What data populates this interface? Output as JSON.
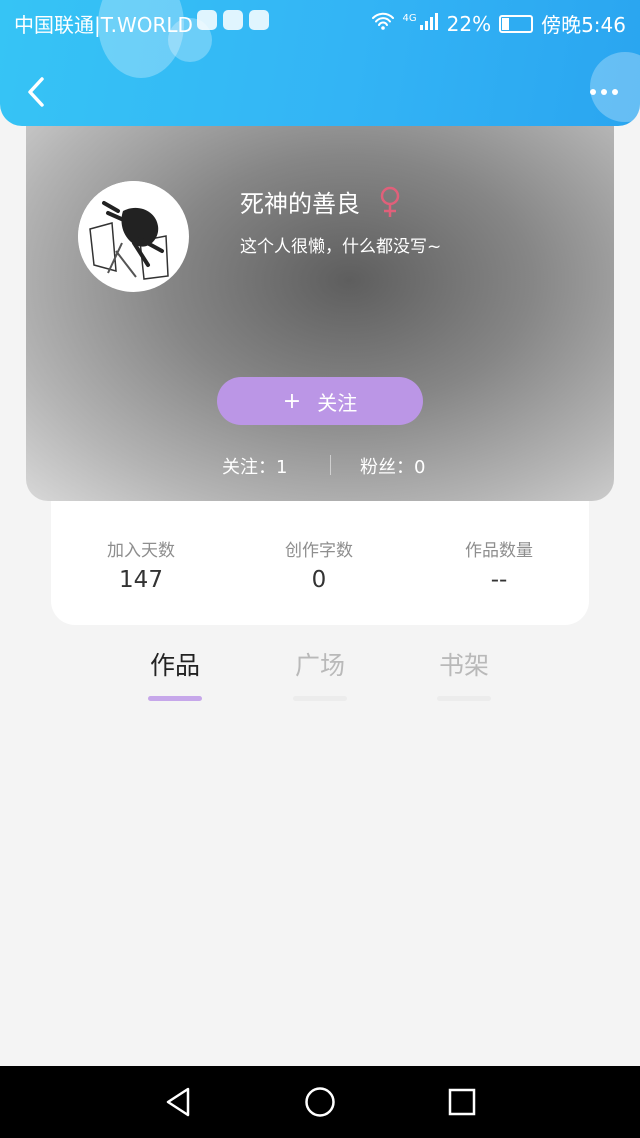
{
  "status_bar": {
    "carrier": "中国联通|T.WORLD",
    "battery": "22%",
    "time": "傍晚5:46",
    "network": "4G",
    "battery_level": 0.22,
    "icons": [
      "music-app-icon",
      "browser-app-icon",
      "huawei-app-icon",
      "wifi-icon",
      "signal-icon",
      "battery-icon"
    ]
  },
  "header": {
    "back_icon": "chevron-left-icon",
    "more_icon": "more-dots-icon",
    "color": "#33b4f5"
  },
  "profile": {
    "name": "死神的善良",
    "gender_icon": "female-icon",
    "gender_color": "#e0607a",
    "bio": "这个人很懒，什么都没写~",
    "follow_button": "关注",
    "follow_button_color": "#bb96e6",
    "following": "关注：1",
    "fans": "粉丝：0"
  },
  "stats": [
    {
      "label": "加入天数",
      "value": "147"
    },
    {
      "label": "创作字数",
      "value": "0"
    },
    {
      "label": "作品数量",
      "value": "--"
    }
  ],
  "tabs": [
    {
      "label": "作品",
      "active": true
    },
    {
      "label": "广场",
      "active": false
    },
    {
      "label": "书架",
      "active": false
    }
  ],
  "accent_color": "#c6a7ea",
  "nav_bar": {
    "buttons": [
      "back-triangle-icon",
      "home-circle-icon",
      "recents-square-icon"
    ]
  }
}
